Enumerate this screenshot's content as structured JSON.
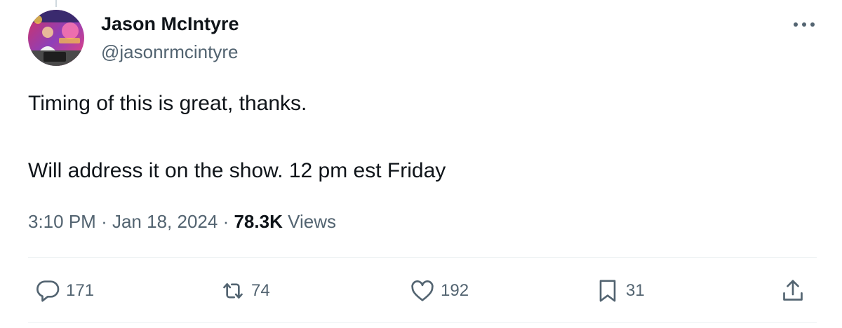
{
  "author": {
    "name": "Jason McIntyre",
    "handle": "@jasonrmcintyre"
  },
  "tweet": {
    "paragraphs": [
      "Timing of this is great, thanks.",
      "Will address it on the show. 12 pm est Friday"
    ]
  },
  "meta": {
    "time": "3:10 PM",
    "separator": "·",
    "date": "Jan 18, 2024",
    "views_count": "78.3K",
    "views_label": "Views"
  },
  "actions": {
    "replies": "171",
    "reposts": "74",
    "likes": "192",
    "bookmarks": "31"
  },
  "icons": {
    "more": "more-horizontal-icon",
    "reply": "reply-bubble-icon",
    "repost": "repost-icon",
    "like": "heart-icon",
    "bookmark": "bookmark-icon",
    "share": "share-icon"
  },
  "colors": {
    "text": "#0f1419",
    "secondary": "#536471",
    "divider": "#eff3f4"
  }
}
